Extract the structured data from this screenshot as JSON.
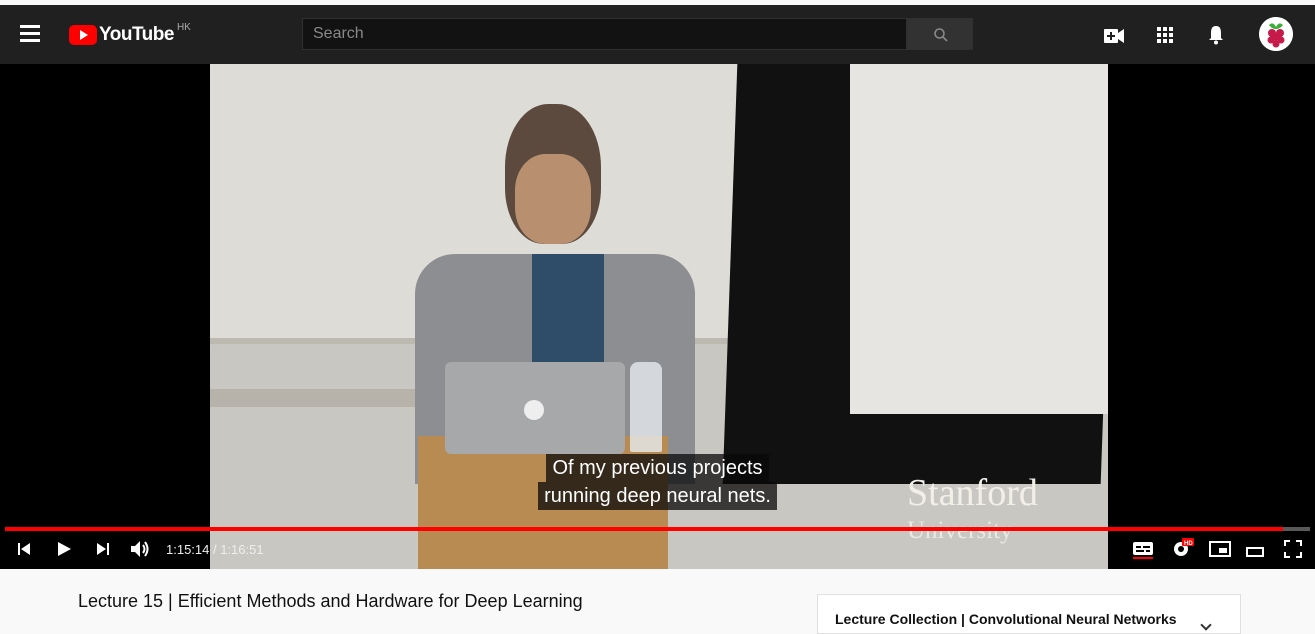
{
  "header": {
    "logo_text": "YouTube",
    "country_code": "HK",
    "search": {
      "placeholder": "Search",
      "value": ""
    },
    "icons": [
      "menu-icon",
      "search-icon",
      "create-video-icon",
      "apps-grid-icon",
      "notifications-bell-icon",
      "avatar"
    ]
  },
  "player": {
    "captions": [
      "Of my previous projects",
      "running deep neural nets."
    ],
    "watermark": {
      "line1": "Stanford",
      "line2": "University"
    },
    "current_time": "1:15:14",
    "duration": "1:16:51",
    "time_display": "1:15:14 / 1:16:51",
    "progress_fraction": 0.979,
    "controls_left": [
      "previous-icon",
      "play-icon",
      "next-icon",
      "volume-icon"
    ],
    "controls_right": [
      "subtitles-icon",
      "settings-hd-icon",
      "miniplayer-icon",
      "theater-mode-icon",
      "fullscreen-icon"
    ],
    "accent_color": "#ff0000"
  },
  "video": {
    "title": "Lecture 15 | Efficient Methods and Hardware for Deep Learning"
  },
  "playlist": {
    "title": "Lecture Collection | Convolutional Neural Networks fc"
  }
}
